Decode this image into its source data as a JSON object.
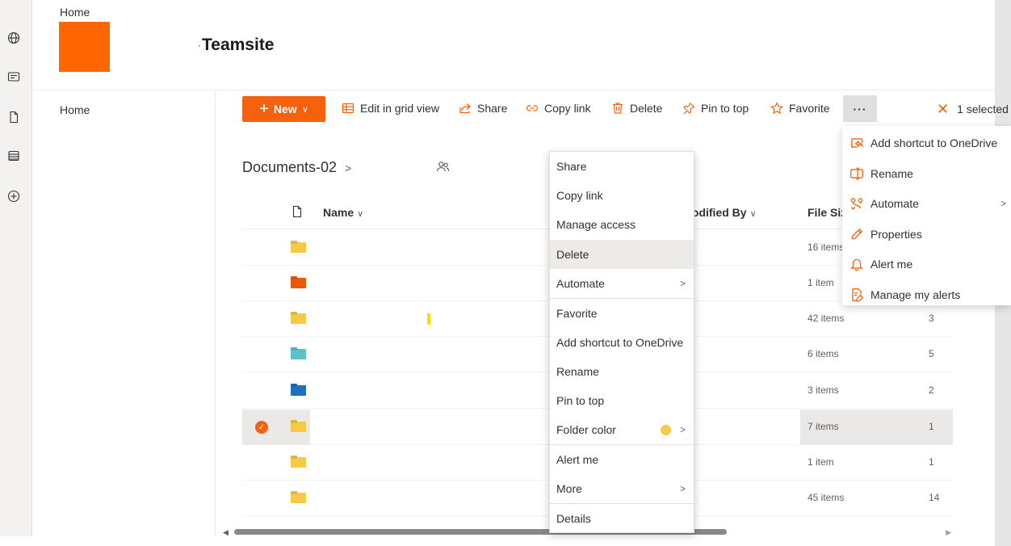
{
  "site": {
    "top_nav_label": "Home",
    "title": "Teamsite",
    "logo_color": "#ff6600"
  },
  "left_nav": {
    "items": [
      {
        "label": "Home"
      }
    ]
  },
  "app_rail": {
    "icons": [
      "globe-icon",
      "news-icon",
      "document-icon",
      "list-icon",
      "add-circle-icon"
    ]
  },
  "command_bar": {
    "new_label": "New",
    "edit_grid_label": "Edit in grid view",
    "share_label": "Share",
    "copy_link_label": "Copy link",
    "delete_label": "Delete",
    "pin_label": "Pin to top",
    "favorite_label": "Favorite",
    "more_label": "···",
    "selected_label": "1 selected",
    "accent_color": "#f5620e"
  },
  "library": {
    "title": "Documents-02",
    "columns": {
      "name": "Name",
      "modified_by": "lodified By",
      "file_size": "File Siz"
    },
    "rows": [
      {
        "folder_color": "#f7c948",
        "file_size": "16 items",
        "item_count": "",
        "selected": false
      },
      {
        "folder_color": "#e8590c",
        "file_size": "1 item",
        "item_count": "",
        "selected": false
      },
      {
        "folder_color": "#f7c948",
        "file_size": "42 items",
        "item_count": "3",
        "selected": false
      },
      {
        "folder_color": "#5bc0c8",
        "file_size": "6 items",
        "item_count": "5",
        "selected": false
      },
      {
        "folder_color": "#1e6fc2",
        "file_size": "3 items",
        "item_count": "2",
        "selected": false
      },
      {
        "folder_color": "#f7c948",
        "file_size": "7 items",
        "item_count": "1",
        "selected": true
      },
      {
        "folder_color": "#f7c948",
        "file_size": "1 item",
        "item_count": "1",
        "selected": false
      },
      {
        "folder_color": "#f7c948",
        "file_size": "45 items",
        "item_count": "14",
        "selected": false
      }
    ]
  },
  "context_menu": {
    "items": [
      {
        "label": "Share"
      },
      {
        "label": "Copy link"
      },
      {
        "label": "Manage access"
      },
      {
        "label": "Delete",
        "hover": true
      },
      {
        "label": "Automate",
        "submenu": true
      },
      {
        "label": "Favorite"
      },
      {
        "label": "Add shortcut to OneDrive"
      },
      {
        "label": "Rename"
      },
      {
        "label": "Pin to top"
      },
      {
        "label": "Folder color",
        "submenu": true,
        "color": "#f7c948"
      },
      {
        "label": "Alert me"
      },
      {
        "label": "More",
        "submenu": true
      },
      {
        "label": "Details"
      }
    ]
  },
  "more_menu": {
    "items": [
      {
        "label": "Add shortcut to OneDrive",
        "icon": "shortcut-icon"
      },
      {
        "label": "Rename",
        "icon": "rename-icon"
      },
      {
        "label": "Automate",
        "icon": "automate-icon",
        "submenu": true
      },
      {
        "label": "Properties",
        "icon": "pencil-icon"
      },
      {
        "label": "Alert me",
        "icon": "bell-icon"
      },
      {
        "label": "Manage my alerts",
        "icon": "manage-alerts-icon"
      }
    ]
  }
}
